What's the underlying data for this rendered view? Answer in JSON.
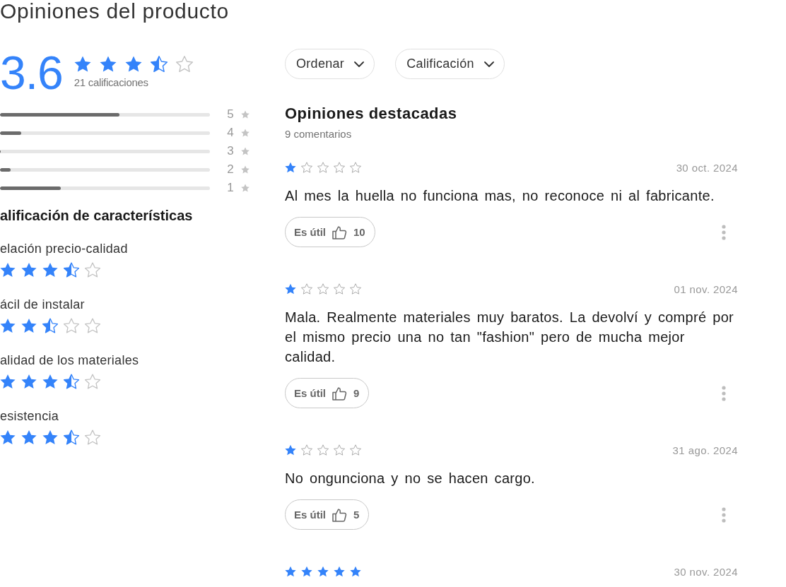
{
  "title": "Opiniones del producto",
  "summary": {
    "average": "3.6",
    "stars": 3.5,
    "count_label": "21 calificaciones",
    "distribution": [
      {
        "label": "5",
        "level": 0.57
      },
      {
        "label": "4",
        "level": 0.1
      },
      {
        "label": "3",
        "level": 0
      },
      {
        "label": "2",
        "level": 0.05
      },
      {
        "label": "1",
        "level": 0.29
      }
    ]
  },
  "features": {
    "title": "alificación de características",
    "items": [
      {
        "label": "elación precio-calidad",
        "stars": 3.5
      },
      {
        "label": "ácil de instalar",
        "stars": 2.5
      },
      {
        "label": "alidad de los materiales",
        "stars": 3.5
      },
      {
        "label": "esistencia",
        "stars": 3.5
      }
    ]
  },
  "filters": [
    {
      "label": "Ordenar"
    },
    {
      "label": "Calificación"
    }
  ],
  "reviews_header": {
    "title": "Opiniones destacadas",
    "count": "9 comentarios"
  },
  "reviews": [
    {
      "stars": 1,
      "date": "30 oct. 2024",
      "text": "Al mes la huella no funciona mas, no reconoce ni al fabricante.",
      "helpful": {
        "label": "Es útil",
        "count": "10"
      }
    },
    {
      "stars": 1,
      "date": "01 nov. 2024",
      "text": "Mala. Realmente materiales muy baratos. La devolví y compré por el mismo precio una no tan \"fashion\" pero de mucha mejor calidad.",
      "helpful": {
        "label": "Es útil",
        "count": "9"
      }
    },
    {
      "stars": 1,
      "date": "31 ago. 2024",
      "text": "No ongunciona y no se hacen cargo.",
      "helpful": {
        "label": "Es útil",
        "count": "5"
      }
    },
    {
      "stars": 5,
      "date": "30 nov. 2024"
    }
  ]
}
